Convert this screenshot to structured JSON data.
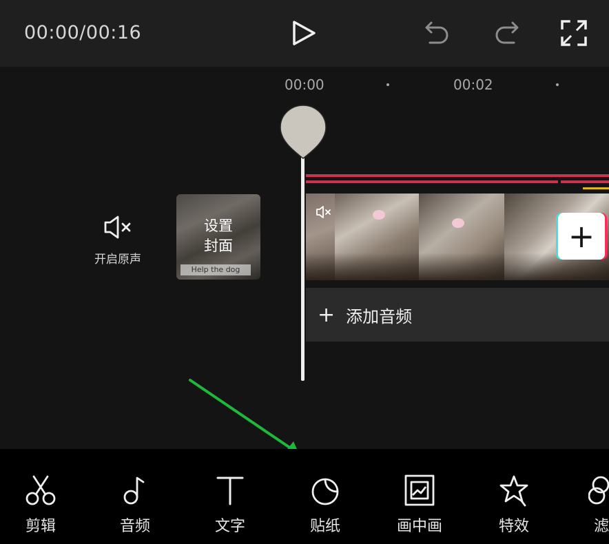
{
  "header": {
    "time": "00:00/00:16",
    "play_icon": "play-icon",
    "undo_icon": "undo-icon",
    "redo_icon": "redo-icon",
    "fullscreen_icon": "fullscreen-icon"
  },
  "ruler": {
    "ticks": [
      "00:00",
      "00:02"
    ]
  },
  "track": {
    "mute_label": "开启原声",
    "cover_line1": "设置",
    "cover_line2": "封面",
    "cover_caption": "Help the dog",
    "add_clip": "+",
    "add_audio_plus": "+",
    "add_audio_label": "添加音频"
  },
  "toolbar": {
    "items": [
      {
        "label": "剪辑",
        "icon": "scissors-icon"
      },
      {
        "label": "音频",
        "icon": "music-note-icon"
      },
      {
        "label": "文字",
        "icon": "text-icon"
      },
      {
        "label": "贴纸",
        "icon": "sticker-icon"
      },
      {
        "label": "画中画",
        "icon": "picture-in-picture-icon"
      },
      {
        "label": "特效",
        "icon": "star-effect-icon"
      },
      {
        "label": "滤",
        "icon": "filter-icon"
      }
    ]
  },
  "colors": {
    "accent_arrow": "#1fb83a",
    "track_red": "#c8344f",
    "track_yellow": "#e0b526"
  }
}
